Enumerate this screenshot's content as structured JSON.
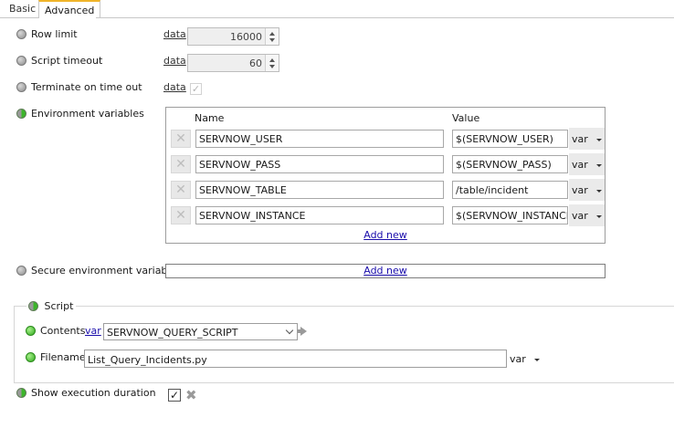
{
  "tabs": [
    {
      "label": "Basic"
    },
    {
      "label": "Advanced"
    }
  ],
  "row_limit": {
    "label": "Row limit",
    "mode": "data",
    "value": "16000"
  },
  "script_timeout": {
    "label": "Script timeout",
    "mode": "data",
    "value": "60"
  },
  "terminate": {
    "label": "Terminate on time out",
    "mode": "data",
    "check": "✓"
  },
  "env": {
    "label": "Environment variables",
    "col_name": "Name",
    "col_value": "Value",
    "rows": [
      {
        "name": "SERVNOW_USER",
        "value": "$(SERVNOW_USER)",
        "type": "var"
      },
      {
        "name": "SERVNOW_PASS",
        "value": "$(SERVNOW_PASS)",
        "type": "var"
      },
      {
        "name": "SERVNOW_TABLE",
        "value": "/table/incident",
        "type": "var"
      },
      {
        "name": "SERVNOW_INSTANCE",
        "value": "$(SERVNOW_INSTANCE)",
        "type": "var"
      }
    ],
    "add_new": "Add new"
  },
  "secure_env": {
    "label": "Secure environment variables",
    "add_new": "Add new"
  },
  "script": {
    "group_label": "Script",
    "contents_label": "Contents",
    "contents_mode": "var",
    "contents_value": "SERVNOW_QUERY_SCRIPT",
    "filename_label": "Filename",
    "filename_value": "List_Query_Incidents.py",
    "filename_type": "var"
  },
  "exec_duration": {
    "label": "Show execution duration",
    "check": "✓",
    "clear": "✖"
  },
  "colors": {
    "tab_accent": "#f0b429",
    "status_green": "#3cb52a",
    "status_gray": "#9a9a9a",
    "link_blue": "#1a0dab"
  }
}
